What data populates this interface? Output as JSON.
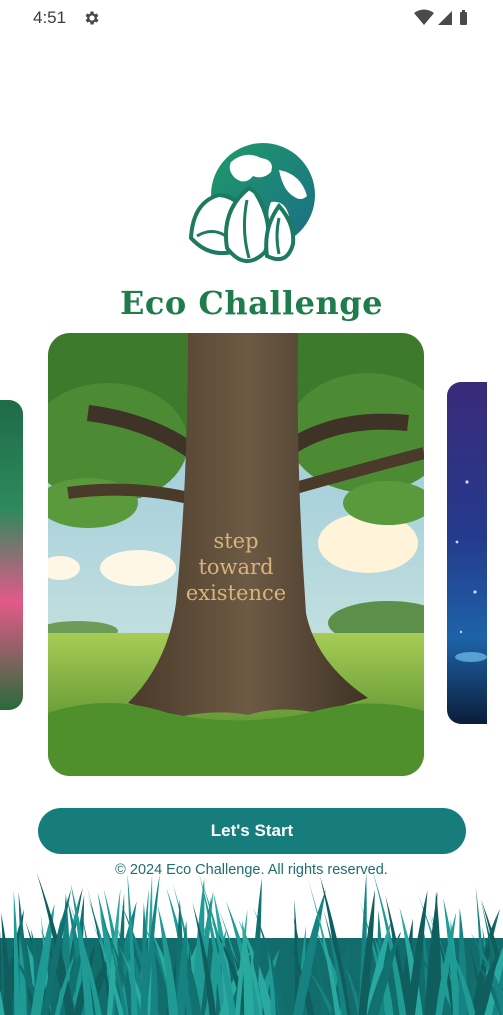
{
  "status_bar": {
    "time": "4:51"
  },
  "app": {
    "title": "Eco Challenge"
  },
  "carousel": {
    "current_slide_text": [
      "step",
      "toward",
      "existence"
    ]
  },
  "actions": {
    "start_label": "Let's Start"
  },
  "footer": {
    "copyright": "© 2024 Eco Challenge. All rights reserved."
  },
  "colors": {
    "primary": "#177c7c",
    "title_green": "#1f7d4c",
    "grass": "#1a8a86"
  },
  "icons": [
    "gear-icon",
    "wifi-icon",
    "cell-signal-icon",
    "battery-icon",
    "eco-globe-leaf-logo"
  ]
}
